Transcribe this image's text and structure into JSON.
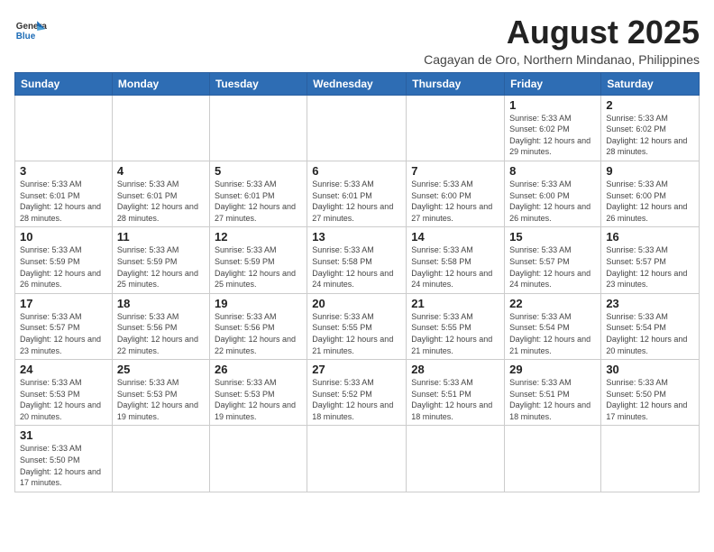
{
  "header": {
    "logo_line1": "General",
    "logo_line2": "Blue",
    "title": "August 2025",
    "subtitle": "Cagayan de Oro, Northern Mindanao, Philippines"
  },
  "days_of_week": [
    "Sunday",
    "Monday",
    "Tuesday",
    "Wednesday",
    "Thursday",
    "Friday",
    "Saturday"
  ],
  "weeks": [
    [
      {
        "day": "",
        "info": ""
      },
      {
        "day": "",
        "info": ""
      },
      {
        "day": "",
        "info": ""
      },
      {
        "day": "",
        "info": ""
      },
      {
        "day": "",
        "info": ""
      },
      {
        "day": "1",
        "info": "Sunrise: 5:33 AM\nSunset: 6:02 PM\nDaylight: 12 hours and 29 minutes."
      },
      {
        "day": "2",
        "info": "Sunrise: 5:33 AM\nSunset: 6:02 PM\nDaylight: 12 hours and 28 minutes."
      }
    ],
    [
      {
        "day": "3",
        "info": "Sunrise: 5:33 AM\nSunset: 6:01 PM\nDaylight: 12 hours and 28 minutes."
      },
      {
        "day": "4",
        "info": "Sunrise: 5:33 AM\nSunset: 6:01 PM\nDaylight: 12 hours and 28 minutes."
      },
      {
        "day": "5",
        "info": "Sunrise: 5:33 AM\nSunset: 6:01 PM\nDaylight: 12 hours and 27 minutes."
      },
      {
        "day": "6",
        "info": "Sunrise: 5:33 AM\nSunset: 6:01 PM\nDaylight: 12 hours and 27 minutes."
      },
      {
        "day": "7",
        "info": "Sunrise: 5:33 AM\nSunset: 6:00 PM\nDaylight: 12 hours and 27 minutes."
      },
      {
        "day": "8",
        "info": "Sunrise: 5:33 AM\nSunset: 6:00 PM\nDaylight: 12 hours and 26 minutes."
      },
      {
        "day": "9",
        "info": "Sunrise: 5:33 AM\nSunset: 6:00 PM\nDaylight: 12 hours and 26 minutes."
      }
    ],
    [
      {
        "day": "10",
        "info": "Sunrise: 5:33 AM\nSunset: 5:59 PM\nDaylight: 12 hours and 26 minutes."
      },
      {
        "day": "11",
        "info": "Sunrise: 5:33 AM\nSunset: 5:59 PM\nDaylight: 12 hours and 25 minutes."
      },
      {
        "day": "12",
        "info": "Sunrise: 5:33 AM\nSunset: 5:59 PM\nDaylight: 12 hours and 25 minutes."
      },
      {
        "day": "13",
        "info": "Sunrise: 5:33 AM\nSunset: 5:58 PM\nDaylight: 12 hours and 24 minutes."
      },
      {
        "day": "14",
        "info": "Sunrise: 5:33 AM\nSunset: 5:58 PM\nDaylight: 12 hours and 24 minutes."
      },
      {
        "day": "15",
        "info": "Sunrise: 5:33 AM\nSunset: 5:57 PM\nDaylight: 12 hours and 24 minutes."
      },
      {
        "day": "16",
        "info": "Sunrise: 5:33 AM\nSunset: 5:57 PM\nDaylight: 12 hours and 23 minutes."
      }
    ],
    [
      {
        "day": "17",
        "info": "Sunrise: 5:33 AM\nSunset: 5:57 PM\nDaylight: 12 hours and 23 minutes."
      },
      {
        "day": "18",
        "info": "Sunrise: 5:33 AM\nSunset: 5:56 PM\nDaylight: 12 hours and 22 minutes."
      },
      {
        "day": "19",
        "info": "Sunrise: 5:33 AM\nSunset: 5:56 PM\nDaylight: 12 hours and 22 minutes."
      },
      {
        "day": "20",
        "info": "Sunrise: 5:33 AM\nSunset: 5:55 PM\nDaylight: 12 hours and 21 minutes."
      },
      {
        "day": "21",
        "info": "Sunrise: 5:33 AM\nSunset: 5:55 PM\nDaylight: 12 hours and 21 minutes."
      },
      {
        "day": "22",
        "info": "Sunrise: 5:33 AM\nSunset: 5:54 PM\nDaylight: 12 hours and 21 minutes."
      },
      {
        "day": "23",
        "info": "Sunrise: 5:33 AM\nSunset: 5:54 PM\nDaylight: 12 hours and 20 minutes."
      }
    ],
    [
      {
        "day": "24",
        "info": "Sunrise: 5:33 AM\nSunset: 5:53 PM\nDaylight: 12 hours and 20 minutes."
      },
      {
        "day": "25",
        "info": "Sunrise: 5:33 AM\nSunset: 5:53 PM\nDaylight: 12 hours and 19 minutes."
      },
      {
        "day": "26",
        "info": "Sunrise: 5:33 AM\nSunset: 5:53 PM\nDaylight: 12 hours and 19 minutes."
      },
      {
        "day": "27",
        "info": "Sunrise: 5:33 AM\nSunset: 5:52 PM\nDaylight: 12 hours and 18 minutes."
      },
      {
        "day": "28",
        "info": "Sunrise: 5:33 AM\nSunset: 5:51 PM\nDaylight: 12 hours and 18 minutes."
      },
      {
        "day": "29",
        "info": "Sunrise: 5:33 AM\nSunset: 5:51 PM\nDaylight: 12 hours and 18 minutes."
      },
      {
        "day": "30",
        "info": "Sunrise: 5:33 AM\nSunset: 5:50 PM\nDaylight: 12 hours and 17 minutes."
      }
    ],
    [
      {
        "day": "31",
        "info": "Sunrise: 5:33 AM\nSunset: 5:50 PM\nDaylight: 12 hours and 17 minutes."
      },
      {
        "day": "",
        "info": ""
      },
      {
        "day": "",
        "info": ""
      },
      {
        "day": "",
        "info": ""
      },
      {
        "day": "",
        "info": ""
      },
      {
        "day": "",
        "info": ""
      },
      {
        "day": "",
        "info": ""
      }
    ]
  ]
}
